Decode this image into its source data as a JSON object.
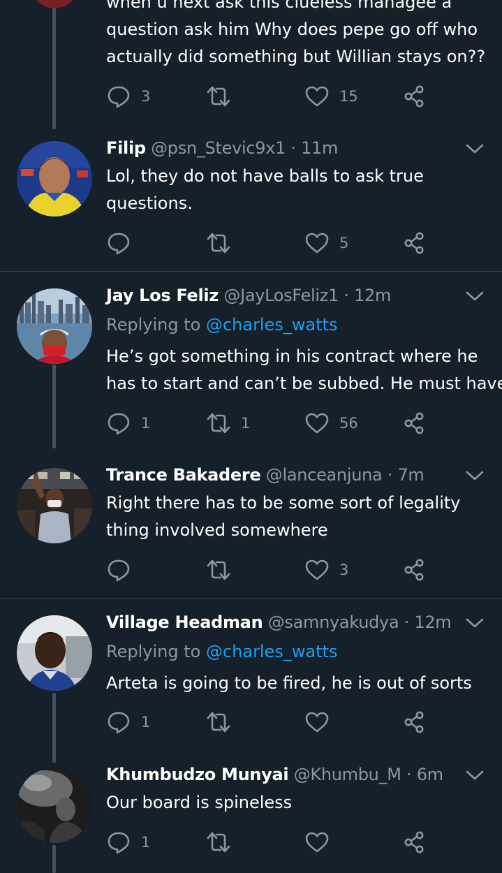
{
  "tweets": [
    {
      "body_lines": [
        "when u next ask this clueless managee a",
        "question ask him Why does pepe go off who",
        "actually did something but Willian stays on??"
      ],
      "replies": "3",
      "retweets": "",
      "likes": "15"
    },
    {
      "name": "Filip",
      "handle": "@psn_Stevic9x1",
      "time": "· 11m",
      "body_lines": [
        "Lol, they do not have balls to ask true",
        "questions."
      ],
      "replies": "",
      "retweets": "",
      "likes": "5"
    },
    {
      "name": "Jay Los Feliz",
      "handle": "@JayLosFeliz1",
      "time": "· 12m",
      "replying_prefix": "Replying to",
      "replying_to": "@charles_watts",
      "body_lines": [
        "He’s got something in his contract where he",
        "has to start and can’t be subbed. He must have."
      ],
      "replies": "1",
      "retweets": "1",
      "likes": "56"
    },
    {
      "name": "Trance Bakadere",
      "handle": "@lanceanjuna",
      "time": "· 7m",
      "body_lines": [
        "Right there has to be some sort of legality",
        "thing involved somewhere"
      ],
      "replies": "",
      "retweets": "",
      "likes": "3"
    },
    {
      "name": "Village Headman",
      "handle": "@samnyakudya",
      "time": "· 12m",
      "replying_prefix": "Replying to",
      "replying_to": "@charles_watts",
      "body_lines": [
        "Arteta is going to be fired, he is out of sorts"
      ],
      "replies": "1",
      "retweets": "",
      "likes": ""
    },
    {
      "name": "Khumbudzo Munyai",
      "handle": "@Khumbu_M",
      "time": "· 6m",
      "body_lines": [
        "Our board is spineless"
      ],
      "replies": "1",
      "retweets": "",
      "likes": ""
    }
  ],
  "icons": {
    "reply": "reply-bubble-icon",
    "retweet": "retweet-icon",
    "like": "heart-icon",
    "share": "share-icon",
    "menu": "chevron-down-icon"
  },
  "colors": {
    "background": "#15202b",
    "text": "#ffffff",
    "muted": "#8899a6",
    "link": "#1da1f2",
    "divider": "#38444d",
    "thread_line": "#3d5466"
  }
}
